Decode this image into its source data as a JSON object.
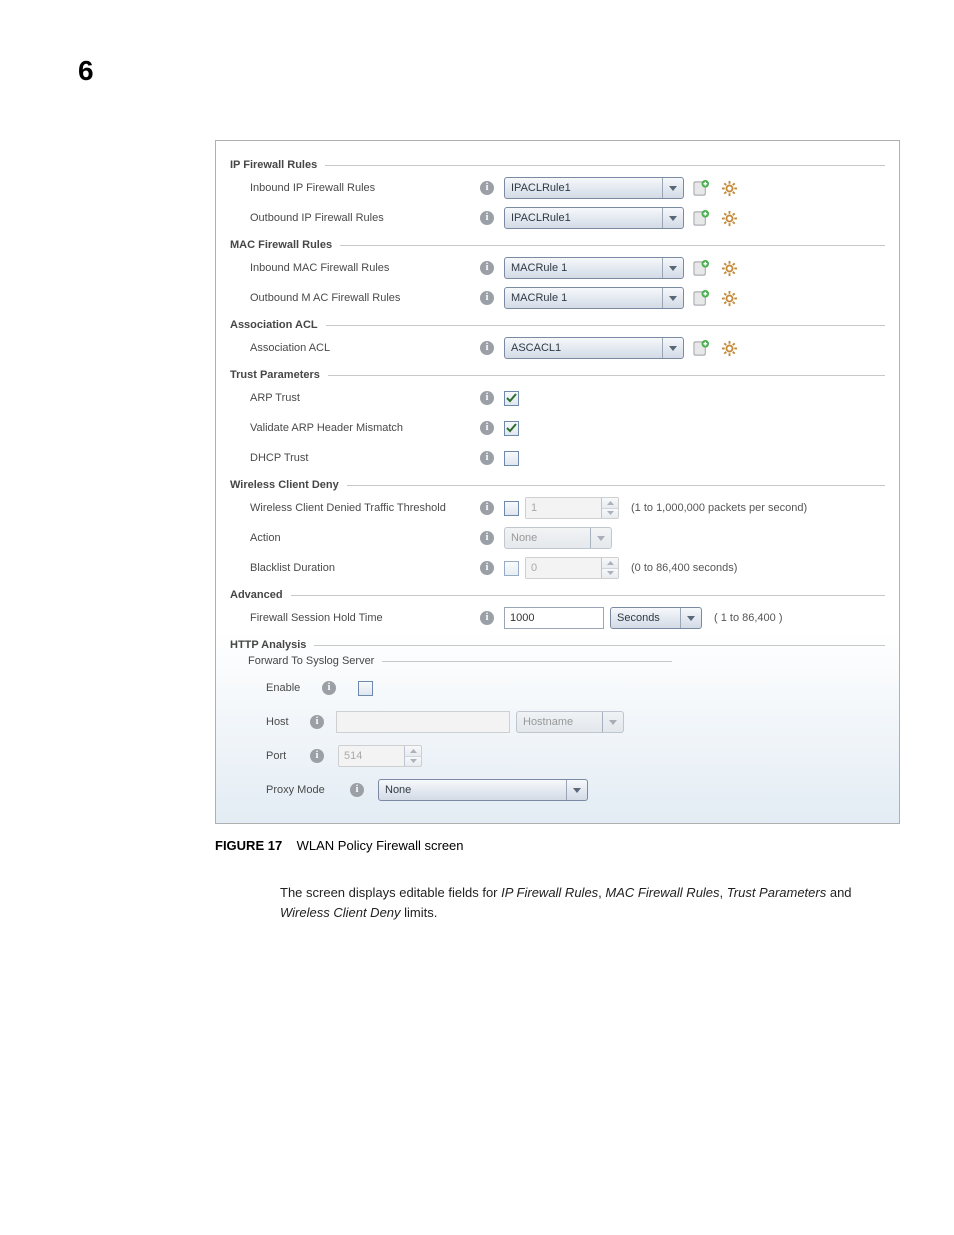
{
  "page_number": "6",
  "sections": {
    "ip": {
      "title": "IP Firewall Rules",
      "inbound_label": "Inbound IP Firewall Rules",
      "inbound_value": "IPACLRule1",
      "outbound_label": "Outbound IP Firewall Rules",
      "outbound_value": "IPACLRule1"
    },
    "mac": {
      "title": "MAC Firewall Rules",
      "inbound_label": "Inbound MAC Firewall Rules",
      "inbound_value": "MACRule 1",
      "outbound_label": "Outbound M AC Firewall Rules",
      "outbound_value": "MACRule 1"
    },
    "assoc": {
      "title": "Association ACL",
      "label": "Association ACL",
      "value": "ASCACL1"
    },
    "trust": {
      "title": "Trust Parameters",
      "arp_label": "ARP Trust",
      "validate_label": "Validate ARP Header Mismatch",
      "dhcp_label": "DHCP Trust"
    },
    "deny": {
      "title": "Wireless Client Deny",
      "threshold_label": "Wireless Client Denied Traffic Threshold",
      "threshold_value": "1",
      "threshold_hint": "(1 to 1,000,000 packets per second)",
      "action_label": "Action",
      "action_value": "None",
      "blacklist_label": "Blacklist Duration",
      "blacklist_value": "0",
      "blacklist_hint": "(0 to 86,400 seconds)"
    },
    "adv": {
      "title": "Advanced",
      "hold_label": "Firewall Session Hold Time",
      "hold_value": "1000",
      "hold_unit": "Seconds",
      "hold_hint": "( 1 to 86,400 )"
    },
    "http": {
      "title": "HTTP Analysis",
      "sub_title": "Forward To Syslog Server",
      "enable_label": "Enable",
      "host_label": "Host",
      "host_type": "Hostname",
      "port_label": "Port",
      "port_value": "514",
      "proxy_label": "Proxy Mode",
      "proxy_value": "None"
    }
  },
  "caption": {
    "fig_label": "FIGURE 17",
    "fig_title": "WLAN Policy Firewall screen"
  },
  "body": {
    "pre": "The screen displays editable fields for ",
    "i1": "IP Firewall Rules",
    "s1": ", ",
    "i2": "MAC Firewall Rules",
    "s2": ", ",
    "i3": "Trust Parameters",
    "s3": " and ",
    "i4": "Wireless Client Deny",
    "post": " limits."
  }
}
